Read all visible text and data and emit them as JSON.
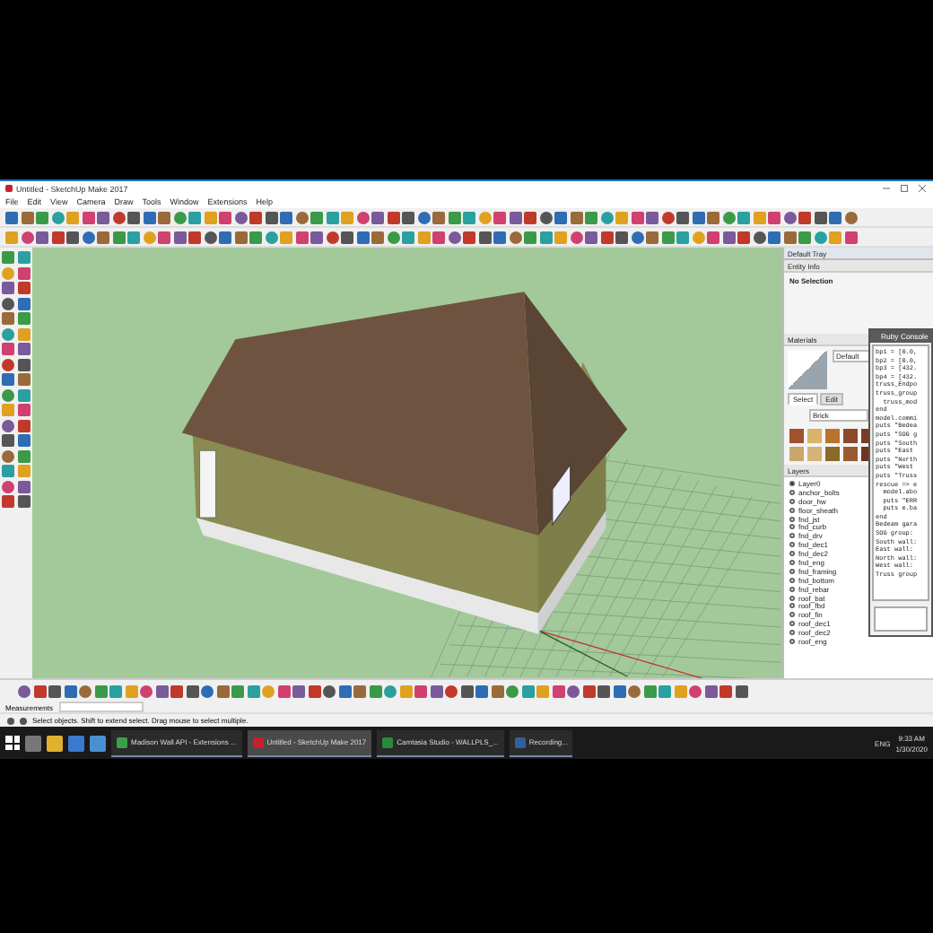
{
  "window": {
    "title": "Untitled - SketchUp Make 2017"
  },
  "menu": [
    "File",
    "Edit",
    "View",
    "Camera",
    "Draw",
    "Tools",
    "Window",
    "Extensions",
    "Help"
  ],
  "tray": {
    "title": "Default Tray",
    "entity_info": {
      "title": "Entity Info",
      "selection": "No Selection"
    },
    "materials": {
      "title": "Materials",
      "name": "Default",
      "library": "Brick",
      "tabs": [
        {
          "label": "Select",
          "selected": true
        },
        {
          "label": "Edit",
          "selected": false
        }
      ],
      "swatches": [
        {
          "color": "#a0522d"
        },
        {
          "color": "#d9b46a"
        },
        {
          "color": "#b8742e"
        },
        {
          "color": "#8a4a2a"
        },
        {
          "color": "#7a3b22"
        },
        {
          "color": "#c9a66b"
        },
        {
          "color": "#d6b478"
        },
        {
          "color": "#8c6a2a"
        },
        {
          "color": "#9a5a30"
        },
        {
          "color": "#6e3420"
        }
      ]
    },
    "layers": {
      "title": "Layers",
      "items": [
        {
          "name": "Layer0",
          "selected": true
        },
        {
          "name": "anchor_bolts",
          "selected": false
        },
        {
          "name": "door_hw",
          "selected": false
        },
        {
          "name": "floor_sheath",
          "selected": false
        },
        {
          "name": "fnd_jst",
          "selected": false
        },
        {
          "name": "fnd_curb",
          "selected": false
        },
        {
          "name": "fnd_drv",
          "selected": false
        },
        {
          "name": "fnd_dec1",
          "selected": false
        },
        {
          "name": "fnd_dec2",
          "selected": false
        },
        {
          "name": "fnd_eng",
          "selected": false
        },
        {
          "name": "fnd_framing",
          "selected": false
        },
        {
          "name": "fnd_bottom",
          "selected": false
        },
        {
          "name": "fnd_rebar",
          "selected": false
        },
        {
          "name": "roof_bat",
          "selected": false
        },
        {
          "name": "roof_fbd",
          "selected": false
        },
        {
          "name": "roof_fin",
          "selected": false
        },
        {
          "name": "roof_dec1",
          "selected": false
        },
        {
          "name": "roof_dec2",
          "selected": false
        },
        {
          "name": "roof_eng",
          "selected": false
        }
      ]
    }
  },
  "ruby_console": {
    "title": "Ruby Console",
    "lines": [
      "bp1 = [0.0,",
      "bp2 = [0.0,",
      "bp3 = [432.",
      "bp4 = [432.",
      "truss_Endpo",
      "truss_group",
      "  truss_mod",
      "end",
      "model.commi",
      "puts \"Bedea",
      "puts \"SOG g",
      "puts \"South",
      "puts \"East ",
      "puts \"North",
      "puts \"West ",
      "puts \"Truss",
      "rescue => e",
      "  model.abo",
      "  puts \"ERR",
      "  puts e.ba",
      "end",
      "Bedeam gara",
      "SOG group: ",
      "South wall:",
      "East wall: ",
      "North wall:",
      "West wall: ",
      "Truss group"
    ]
  },
  "measurements": {
    "label": "Measurements"
  },
  "status_bar": {
    "text": "Select objects. Shift to extend select. Drag mouse to select multiple."
  },
  "taskbar": {
    "items": [
      {
        "label": "Madison Wall API - Extensions ...",
        "active": false
      },
      {
        "label": "Untitled - SketchUp Make 2017",
        "active": true
      },
      {
        "label": "Camtasia Studio - WALLPLS_...",
        "active": false
      },
      {
        "label": "Recording...",
        "active": false
      }
    ],
    "language": "ENG",
    "time": "9:33 AM",
    "date": "1/30/2020"
  }
}
